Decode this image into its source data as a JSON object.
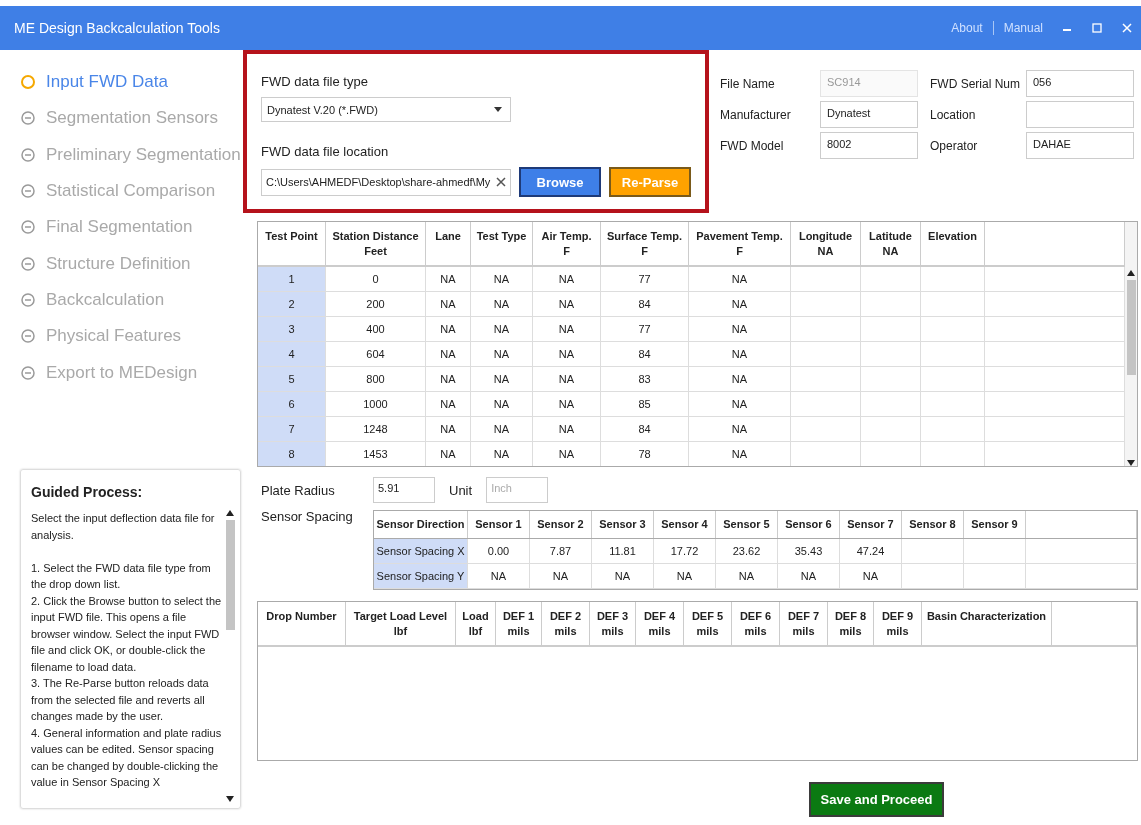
{
  "window": {
    "title": "ME Design Backcalculation Tools",
    "links": [
      "About",
      "Manual"
    ]
  },
  "nav": [
    {
      "label": "Input FWD Data",
      "selected": true
    },
    {
      "label": "Segmentation Sensors",
      "selected": false
    },
    {
      "label": "Preliminary Segmentation",
      "selected": false
    },
    {
      "label": "Statistical Comparison",
      "selected": false
    },
    {
      "label": "Final Segmentation",
      "selected": false
    },
    {
      "label": "Structure Definition",
      "selected": false
    },
    {
      "label": "Backcalculation",
      "selected": false
    },
    {
      "label": "Physical Features",
      "selected": false
    },
    {
      "label": "Export to MEDesign",
      "selected": false
    }
  ],
  "file_type": {
    "label": "FWD data file type",
    "value": "Dynatest V.20 (*.FWD)"
  },
  "file_location": {
    "label": "FWD data file location",
    "value": "C:\\Users\\AHMEDF\\Desktop\\share-ahmedf\\My"
  },
  "file_buttons": [
    {
      "label": "Browse",
      "kind": "primary"
    },
    {
      "label": "Re-Parse",
      "kind": "secondary"
    }
  ],
  "info_fields": [
    {
      "label": "File Name",
      "value": "SC914",
      "disabled": true
    },
    {
      "label": "FWD Serial Num",
      "value": "056",
      "disabled": false
    },
    {
      "label": "Manufacturer",
      "value": "Dynatest",
      "disabled": false
    },
    {
      "label": "Location",
      "disabled": false
    },
    {
      "label": "FWD Model",
      "value": "8002",
      "disabled": false
    },
    {
      "label": "Operator",
      "value": "DAHAE",
      "disabled": false
    }
  ],
  "test_points": {
    "columns": [
      {
        "label": "Test Point"
      },
      {
        "label": "Station Distance",
        "unit": "Feet"
      },
      {
        "label": "Lane"
      },
      {
        "label": "Test Type"
      },
      {
        "label": "Air Temp.",
        "unit": "F"
      },
      {
        "label": "Surface Temp.",
        "unit": "F"
      },
      {
        "label": "Pavement Temp.",
        "unit": "F"
      },
      {
        "label": "Longitude",
        "unit": "NA"
      },
      {
        "label": "Latitude",
        "unit": "NA"
      },
      {
        "label": "Elevation"
      }
    ],
    "rows": [
      [
        "1",
        "0",
        "NA",
        "NA",
        "NA",
        "77",
        "NA"
      ],
      [
        "2",
        "200",
        "NA",
        "NA",
        "NA",
        "84",
        "NA"
      ],
      [
        "3",
        "400",
        "NA",
        "NA",
        "NA",
        "77",
        "NA"
      ],
      [
        "4",
        "604",
        "NA",
        "NA",
        "NA",
        "84",
        "NA"
      ],
      [
        "5",
        "800",
        "NA",
        "NA",
        "NA",
        "83",
        "NA"
      ],
      [
        "6",
        "1000",
        "NA",
        "NA",
        "NA",
        "85",
        "NA"
      ],
      [
        "7",
        "1248",
        "NA",
        "NA",
        "NA",
        "84",
        "NA"
      ],
      [
        "8",
        "1453",
        "NA",
        "NA",
        "NA",
        "78",
        "NA"
      ]
    ]
  },
  "guided": {
    "title": "Guided Process:",
    "text": "Select the input deflection data file for analysis.\n\n1. Select the FWD data file type from the drop down list.\n2. Click the Browse button to select the input FWD file. This opens a file browser window. Select the input FWD file and click OK, or double-click the filename to load data.\n3. The Re-Parse button reloads data from the selected file and reverts all changes made by the user.\n4. General information and plate radius values can be edited. Sensor spacing can be changed by double-clicking the value in Sensor Spacing X"
  },
  "plate_radius": {
    "label": "Plate Radius",
    "value": "5.91",
    "unit_label": "Unit",
    "unit_value": "Inch"
  },
  "sensor_spacing": {
    "label": "Sensor Spacing",
    "columns": [
      "Sensor Direction",
      "Sensor 1",
      "Sensor 2",
      "Sensor 3",
      "Sensor 4",
      "Sensor 5",
      "Sensor 6",
      "Sensor 7",
      "Sensor 8",
      "Sensor 9"
    ],
    "rows": [
      {
        "label": "Sensor Spacing X",
        "values": [
          "0.00",
          "7.87",
          "11.81",
          "17.72",
          "23.62",
          "35.43",
          "47.24"
        ]
      },
      {
        "label": "Sensor Spacing Y",
        "values": [
          "NA",
          "NA",
          "NA",
          "NA",
          "NA",
          "NA",
          "NA"
        ]
      }
    ]
  },
  "drops": {
    "columns": [
      {
        "label": "Drop Number"
      },
      {
        "label": "Target Load Level",
        "unit": "lbf"
      },
      {
        "label": "Load",
        "unit": "lbf"
      },
      {
        "label": "DEF 1",
        "unit": "mils"
      },
      {
        "label": "DEF 2",
        "unit": "mils"
      },
      {
        "label": "DEF 3",
        "unit": "mils"
      },
      {
        "label": "DEF 4",
        "unit": "mils"
      },
      {
        "label": "DEF 5",
        "unit": "mils"
      },
      {
        "label": "DEF 6",
        "unit": "mils"
      },
      {
        "label": "DEF 7",
        "unit": "mils"
      },
      {
        "label": "DEF 8",
        "unit": "mils"
      },
      {
        "label": "DEF 9",
        "unit": "mils"
      },
      {
        "label": "Basin Characterization"
      }
    ]
  },
  "save_button": "Save and Proceed"
}
